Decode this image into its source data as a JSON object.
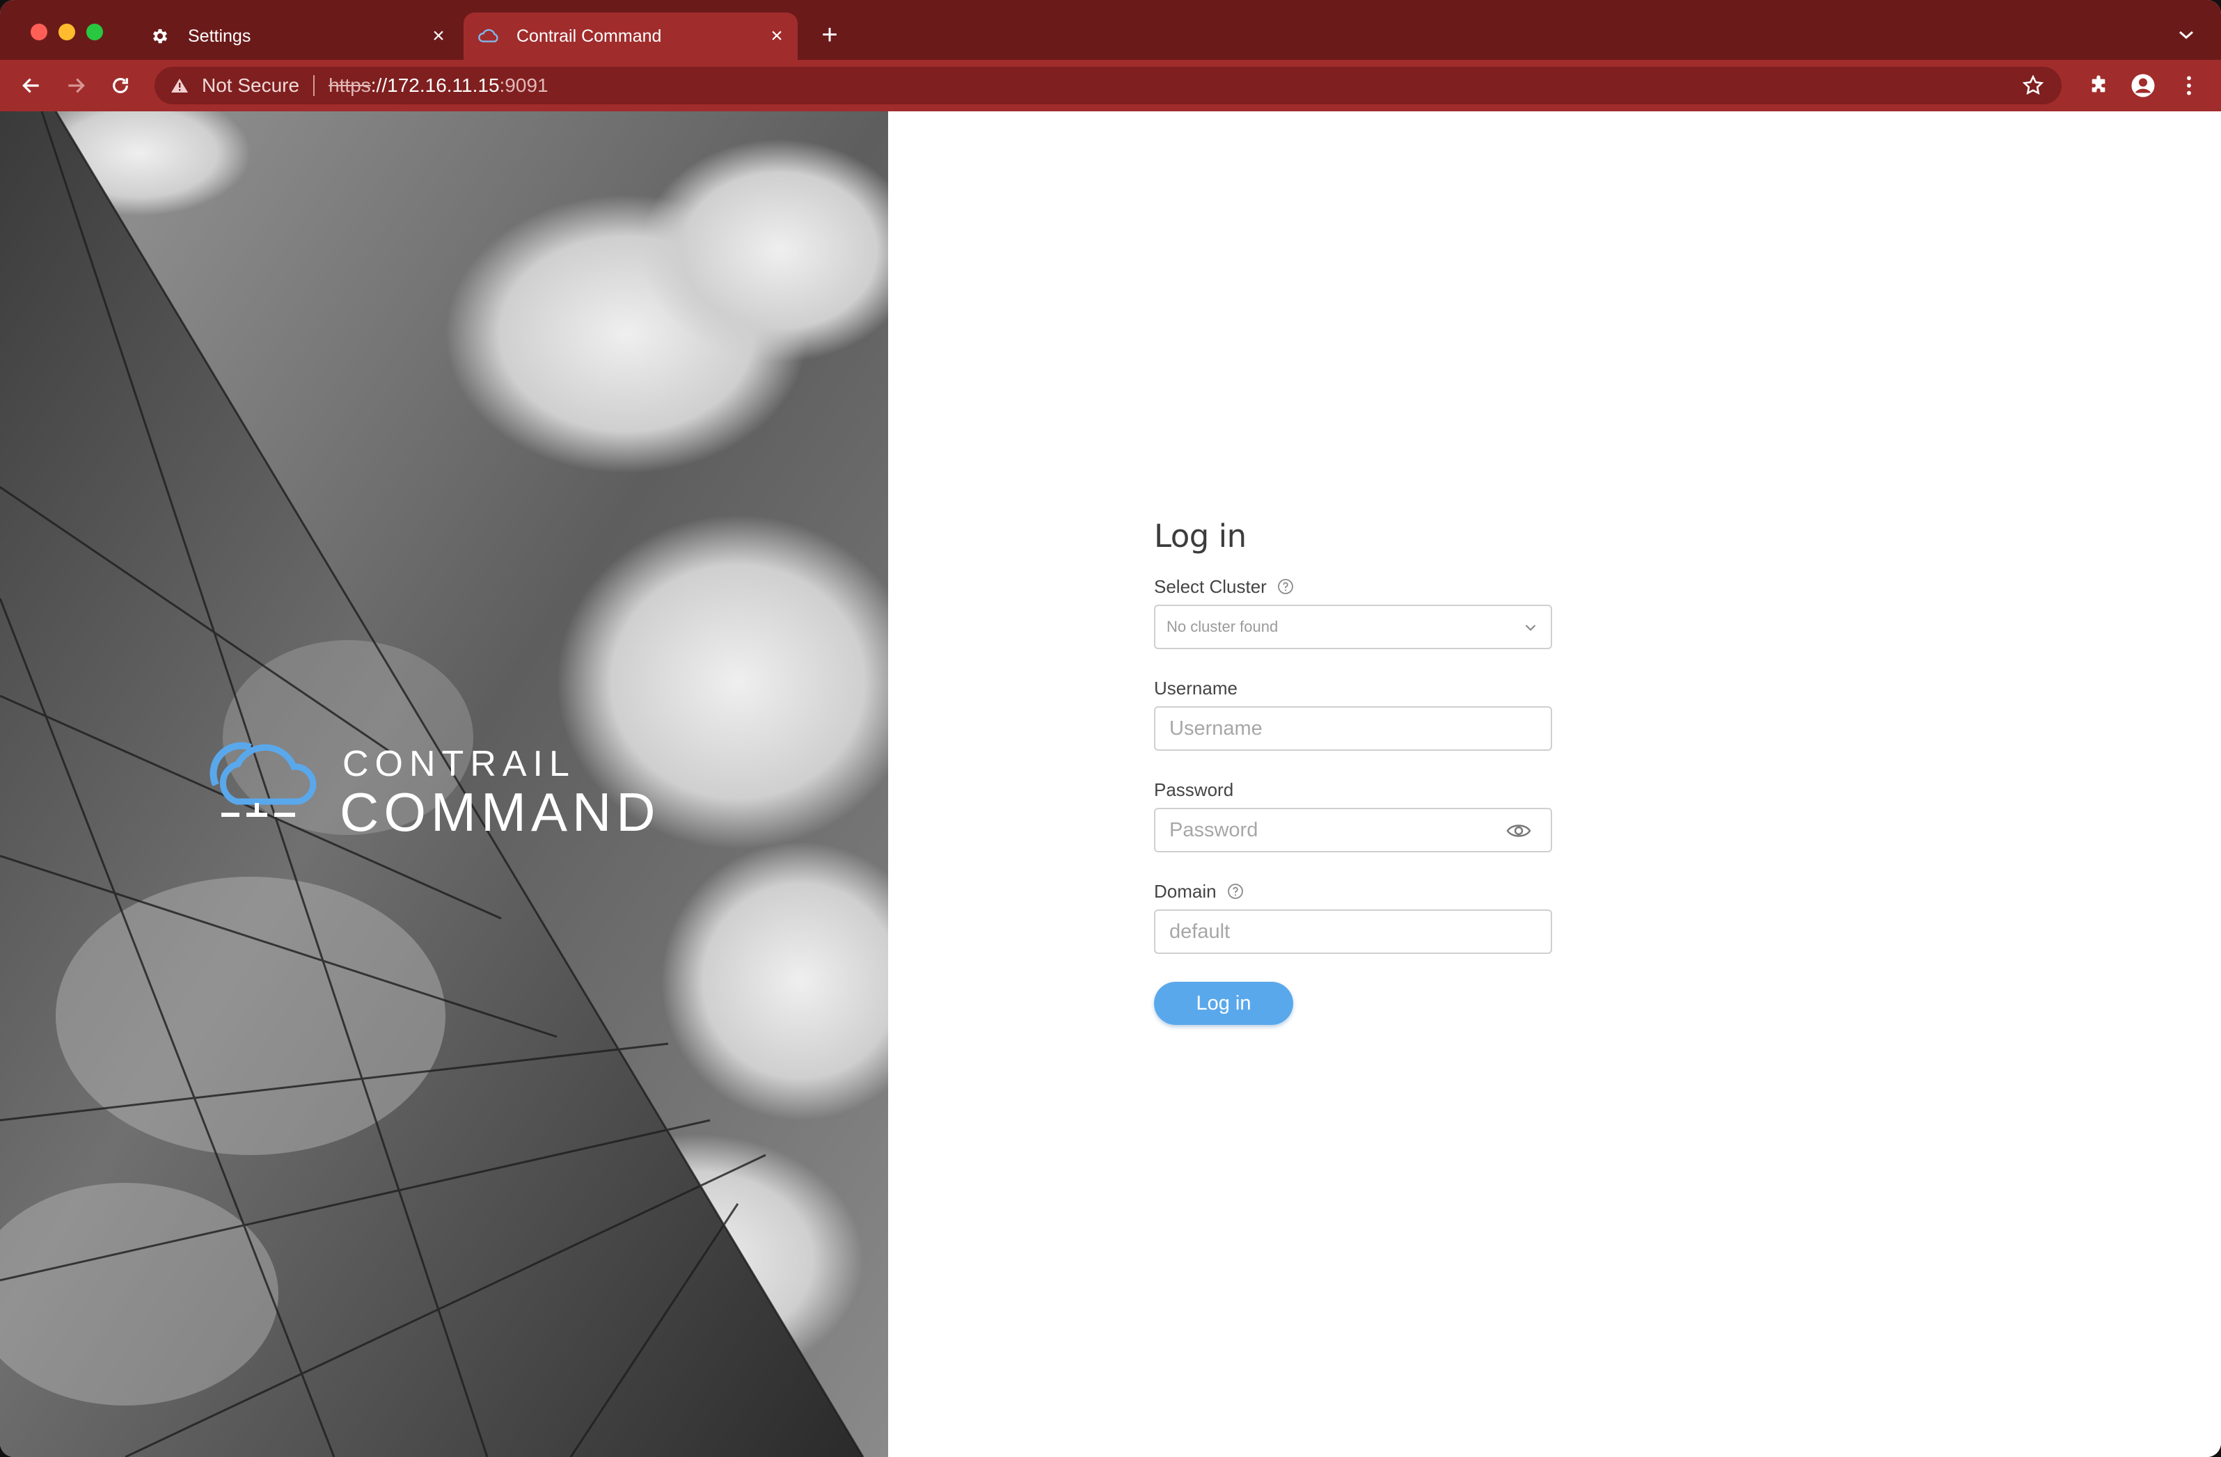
{
  "browser": {
    "tabs": [
      {
        "title": "Settings",
        "icon": "gear-icon"
      },
      {
        "title": "Contrail Command",
        "icon": "cloud-favicon-icon"
      }
    ],
    "new_tab_icon": "plus-icon",
    "address": {
      "security_label": "Not Secure",
      "scheme": "https",
      "host": "://172.16.11.15",
      "port": ":9091"
    },
    "colors": {
      "tabstrip": "#6b1a1a",
      "toolbar": "#a12c2c",
      "active_tab": "#a12c2c"
    }
  },
  "brand": {
    "line1": "CONTRAIL",
    "line2": "COMMAND",
    "accent": "#5aa8ec"
  },
  "login": {
    "title": "Log in",
    "cluster_label": "Select Cluster",
    "cluster_value": "No cluster found",
    "username_label": "Username",
    "username_placeholder": "Username",
    "password_label": "Password",
    "password_placeholder": "Password",
    "domain_label": "Domain",
    "domain_placeholder": "default",
    "submit_label": "Log in"
  }
}
